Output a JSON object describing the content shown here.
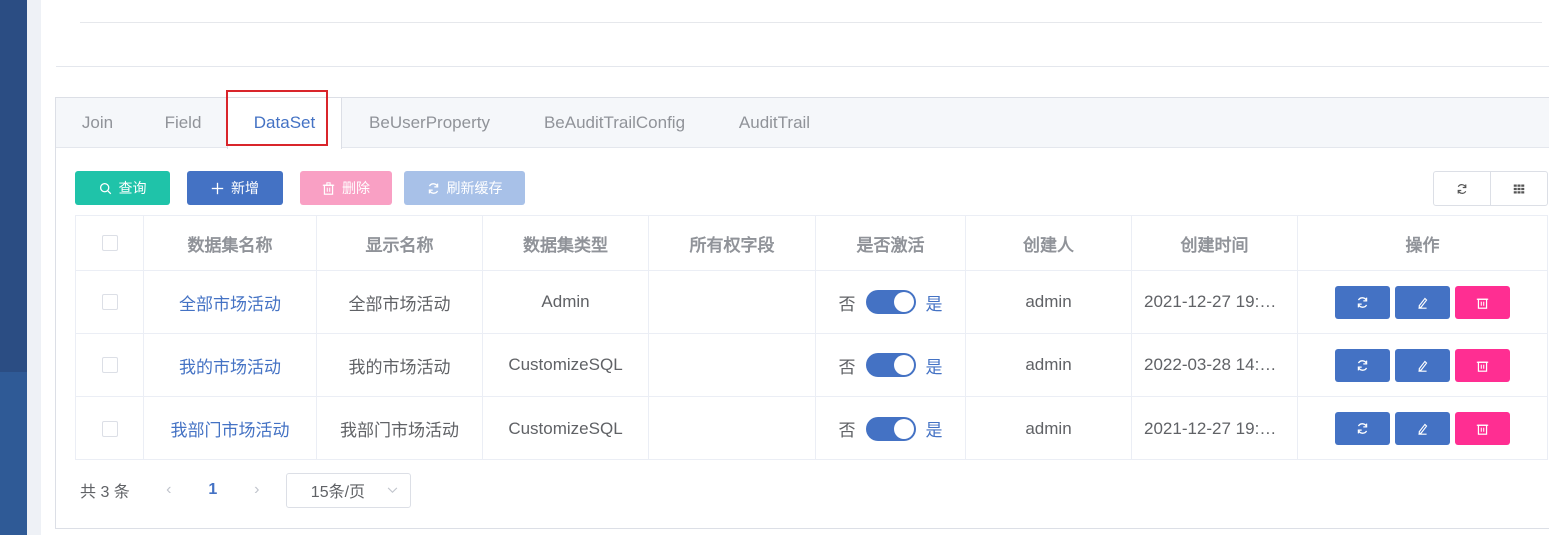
{
  "tabs": [
    {
      "label": "Join"
    },
    {
      "label": "Field"
    },
    {
      "label": "DataSet"
    },
    {
      "label": "BeUserProperty"
    },
    {
      "label": "BeAuditTrailConfig"
    },
    {
      "label": "AuditTrail"
    }
  ],
  "active_tab": "DataSet",
  "toolbar": {
    "query_label": "查询",
    "add_label": "新增",
    "delete_label": "删除",
    "refresh_cache_label": "刷新缓存"
  },
  "table": {
    "headers": [
      "数据集名称",
      "显示名称",
      "数据集类型",
      "所有权字段",
      "是否激活",
      "创建人",
      "创建时间",
      "操作"
    ],
    "rows": [
      {
        "name": "全部市场活动",
        "display": "全部市场活动",
        "type": "Admin",
        "owner_field": "",
        "active_off": "否",
        "active_on": "是",
        "creator": "admin",
        "created": "2021-12-27 19:…"
      },
      {
        "name": "我的市场活动",
        "display": "我的市场活动",
        "type": "CustomizeSQL",
        "owner_field": "",
        "active_off": "否",
        "active_on": "是",
        "creator": "admin",
        "created": "2022-03-28 14:…"
      },
      {
        "name": "我部门市场活动",
        "display": "我部门市场活动",
        "type": "CustomizeSQL",
        "owner_field": "",
        "active_off": "否",
        "active_on": "是",
        "creator": "admin",
        "created": "2021-12-27 19:…"
      }
    ]
  },
  "pagination": {
    "total_text": "共 3 条",
    "current_page": "1",
    "page_size": "15条/页"
  },
  "colors": {
    "primary": "#4472c4",
    "query": "#1fc3a9",
    "danger": "#ff2e92",
    "highlight": "#d9252b"
  }
}
